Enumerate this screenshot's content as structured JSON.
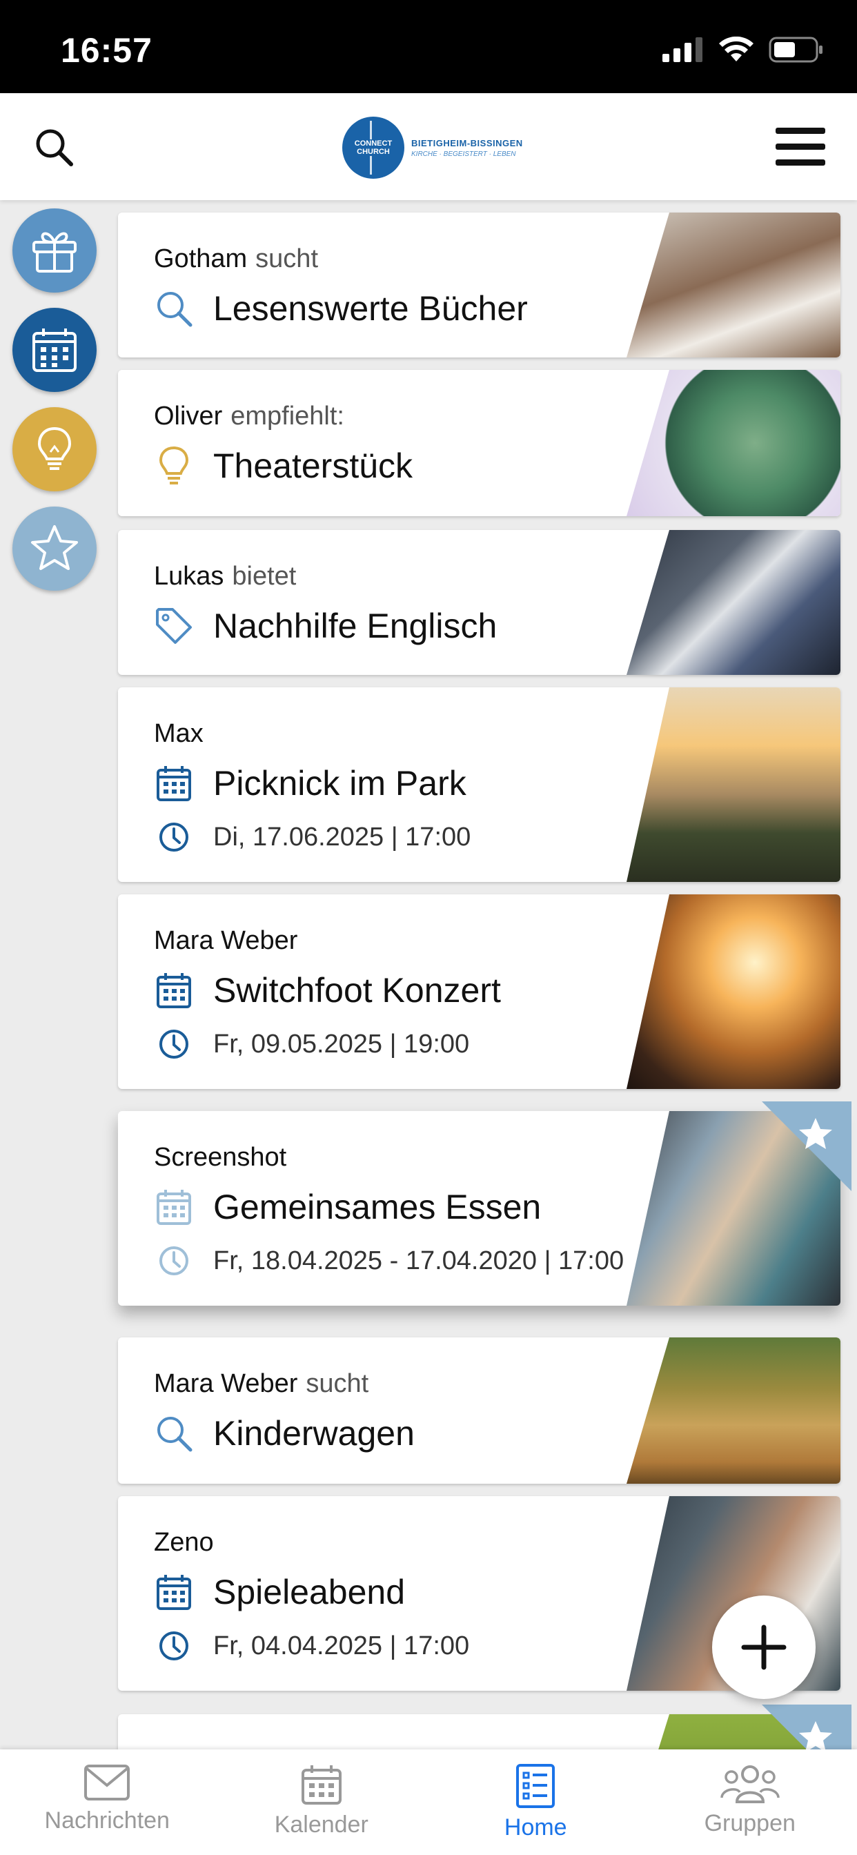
{
  "status": {
    "time": "16:57"
  },
  "header": {
    "logo_line1": "CONNECT",
    "logo_line2": "CHURCH",
    "logo_city": "BIETIGHEIM-BISSINGEN",
    "logo_tagline": "KIRCHE · BEGEISTERT · LEBEN"
  },
  "sidebar": [
    {
      "icon": "gift-icon",
      "color": "#5b93c4"
    },
    {
      "icon": "calendar-icon",
      "color": "#1a5c98"
    },
    {
      "icon": "lightbulb-icon",
      "color": "#d9ad45"
    },
    {
      "icon": "star-icon",
      "color": "#8fb4d0"
    }
  ],
  "cards": [
    {
      "author": "Gotham",
      "verb": "sucht",
      "icon": "search-icon",
      "title": "Lesenswerte Bücher"
    },
    {
      "author": "Oliver",
      "verb": "empfiehlt:",
      "icon": "lightbulb-icon",
      "title": "Theaterstück"
    },
    {
      "author": "Lukas",
      "verb": "bietet",
      "icon": "tag-icon",
      "title": "Nachhilfe Englisch"
    },
    {
      "author": "Max",
      "verb": "",
      "icon": "calendar-icon",
      "title": "Picknick im Park",
      "date": "Di, 17.06.2025 | 17:00"
    },
    {
      "author": "Mara Weber",
      "verb": "",
      "icon": "calendar-icon",
      "title": "Switchfoot Konzert",
      "date": "Fr, 09.05.2025 | 19:00"
    },
    {
      "author": "Screenshot",
      "verb": "",
      "icon": "calendar-icon",
      "title": "Gemeinsames Essen",
      "date": "Fr, 18.04.2025 - 17.04.2020 | 17:00",
      "favorite": true
    },
    {
      "author": "Mara Weber",
      "verb": "sucht",
      "icon": "search-icon",
      "title": "Kinderwagen"
    },
    {
      "author": "Zeno",
      "verb": "",
      "icon": "calendar-icon",
      "title": "Spieleabend",
      "date": "Fr, 04.04.2025 | 17:00"
    }
  ],
  "tabbar": {
    "tabs": [
      {
        "label": "Nachrichten",
        "icon": "envelope-icon"
      },
      {
        "label": "Kalender",
        "icon": "calendar-icon"
      },
      {
        "label": "Home",
        "icon": "list-icon",
        "active": true
      },
      {
        "label": "Gruppen",
        "icon": "group-icon"
      }
    ]
  },
  "colors": {
    "accent": "#1a73e8",
    "brand": "#1a63a8",
    "icon_blue": "#1a5c98",
    "icon_gold": "#d9ad45"
  }
}
